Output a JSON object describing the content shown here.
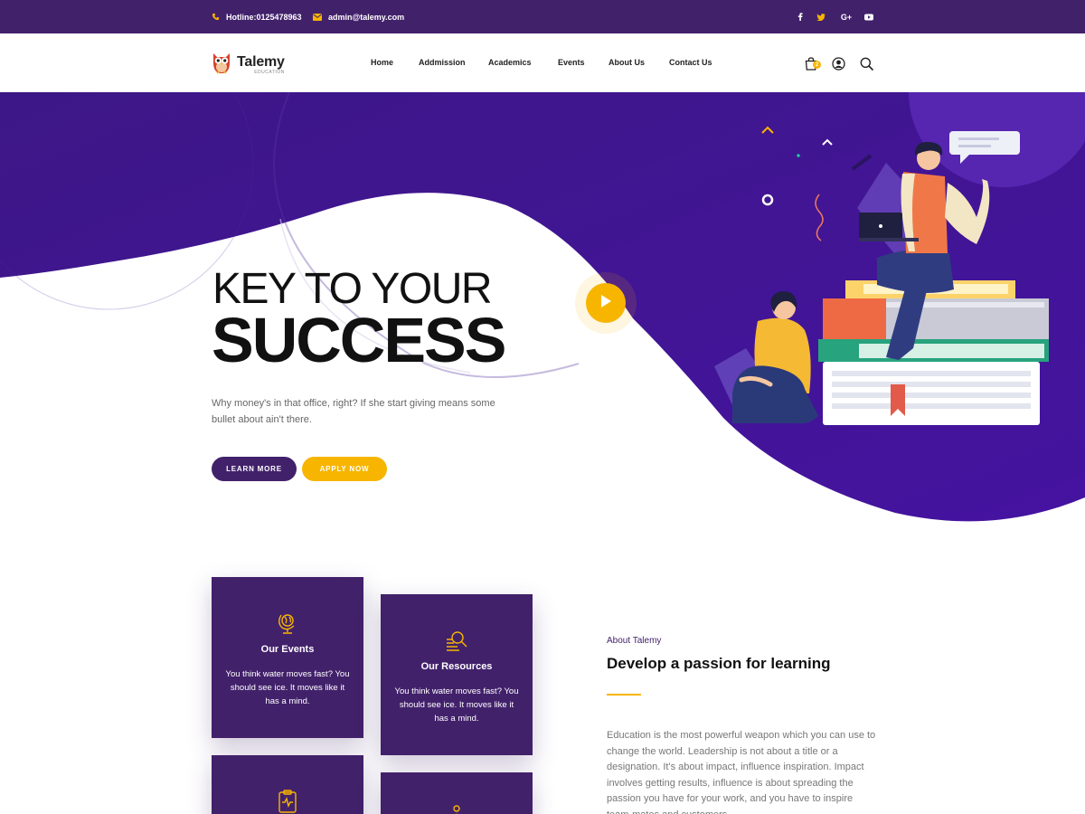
{
  "topbar": {
    "hotline": "Hotline:0125478963",
    "email": "admin@talemy.com",
    "social": [
      "facebook-icon",
      "twitter-icon",
      "google-plus-icon",
      "youtube-icon"
    ],
    "social_labels": {
      "google": "G+"
    }
  },
  "header": {
    "logo_name": "Talemy",
    "logo_sub": "EDUCATION",
    "nav": [
      "Home",
      "Addmission",
      "Academics",
      "Events",
      "About Us",
      "Contact Us"
    ],
    "cart_count": "2",
    "icons": [
      "cart-icon",
      "user-icon",
      "search-icon"
    ]
  },
  "hero": {
    "title_line1": "KEY TO YOUR",
    "title_line2": "SUCCESS",
    "description": "Why money's in that office, right? If she start giving means some bullet about ain't there.",
    "learn_more": "LEARN MORE",
    "apply_now": "APPLY NOW"
  },
  "cards": [
    {
      "title": "Our Events",
      "text": "You think water moves fast? You should see ice. It moves like it has a mind.",
      "icon": "globe-icon"
    },
    {
      "title": "Our Resources",
      "text": "You think water moves fast? You should see ice. It moves like it has a mind.",
      "icon": "magnifier-books-icon"
    },
    {
      "icon": "clipboard-icon"
    },
    {
      "icon": "person-icon"
    }
  ],
  "about": {
    "kicker": "About Talemy",
    "title": "Develop a passion for learning",
    "text": "Education is the most powerful weapon which you can use to change the world. Leadership is not about a title or a designation. It's about impact, influence inspiration. Impact involves getting results, influence is about spreading the passion you have for your work, and you have to inspire team-mates and customers."
  },
  "colors": {
    "primary": "#42216b",
    "accent": "#f7b500",
    "hero_purple": "#3d1a8a"
  }
}
